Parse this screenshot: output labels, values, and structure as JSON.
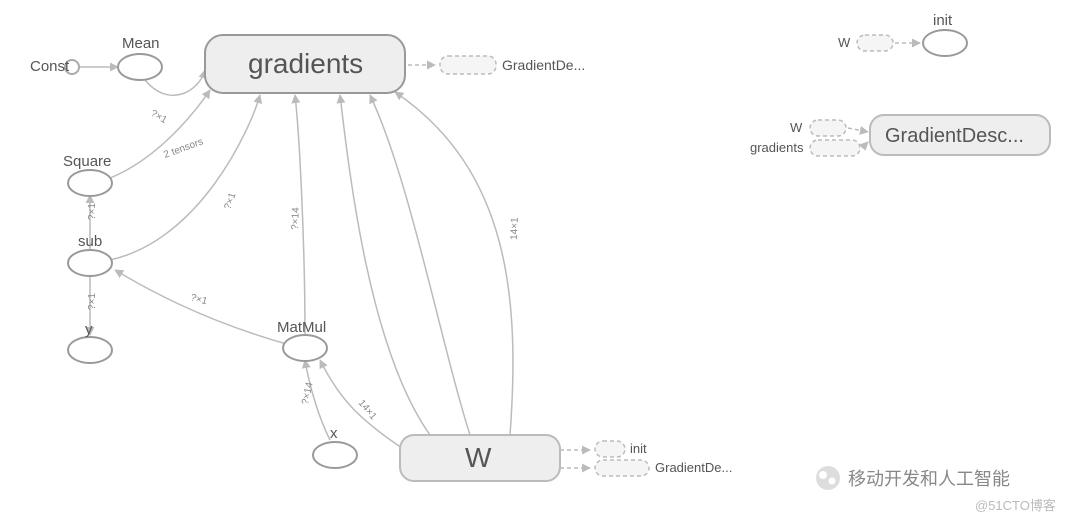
{
  "nodes": {
    "const": "Const",
    "mean": "Mean",
    "square": "Square",
    "sub": "sub",
    "y": "y",
    "matmul": "MatMul",
    "x": "x",
    "gradients": "gradients",
    "w": "W",
    "gradientde": "GradientDe...",
    "init": "init",
    "mini": {
      "w1": "W",
      "init": "init",
      "w2": "W",
      "gradients": "gradients",
      "gd": "GradientDesc..."
    }
  },
  "edge_labels": {
    "mean_grad": "?×1",
    "square_grad": "2 tensors",
    "sub_square": "?×1",
    "sub_y": "?×1",
    "sub_grad": "?×1",
    "matmul_sub": "?×1",
    "matmul_grad": "?×14",
    "x_matmul": "?×14",
    "w_matmul": "14×1",
    "w_grad": "14×1"
  },
  "watermark": {
    "line1": "移动开发和人工智能",
    "line2": "@51CTO博客"
  }
}
